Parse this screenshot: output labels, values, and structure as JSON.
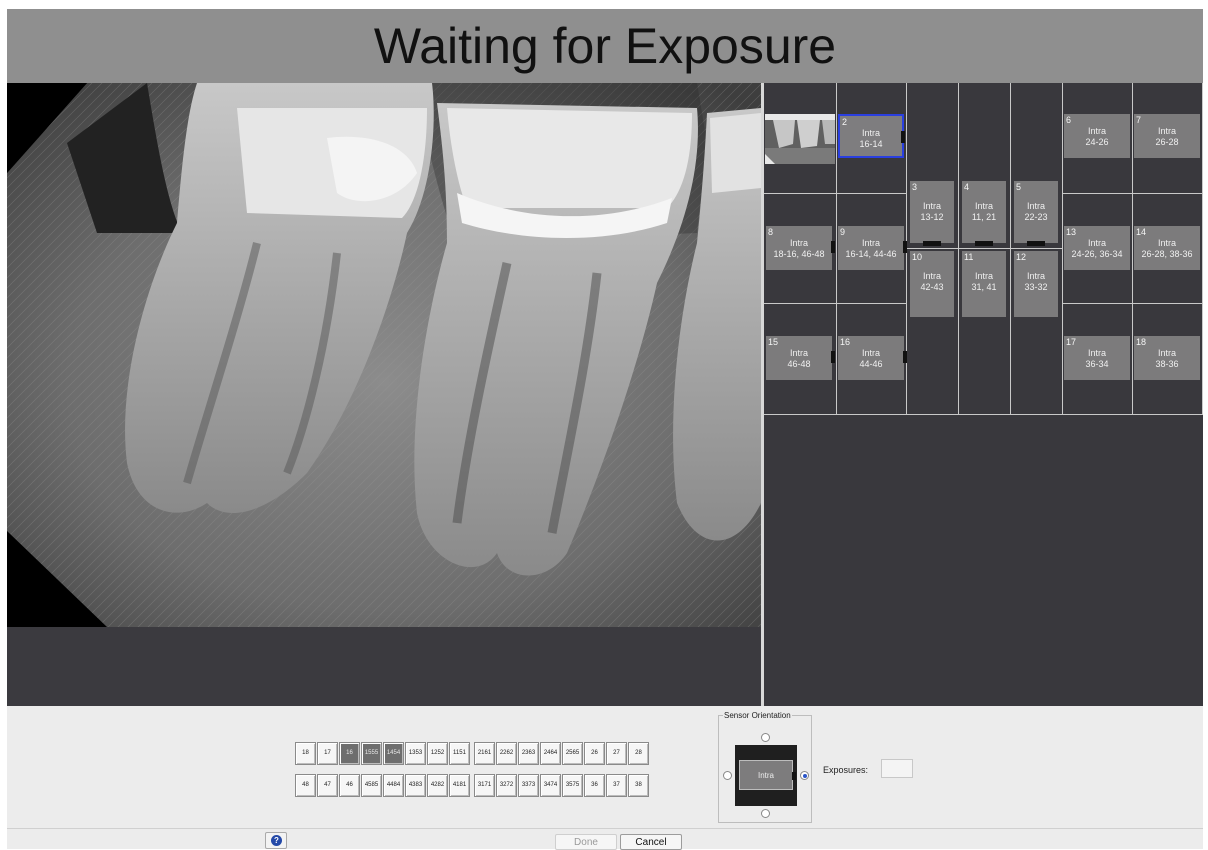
{
  "title": "Waiting for Exposure",
  "accent_selected": "#2a3fe0",
  "mount": {
    "slots": [
      {
        "num": "2",
        "type": "Intra",
        "teeth": "16-14",
        "selected": true
      },
      {
        "num": "3",
        "type": "Intra",
        "teeth": "13-12"
      },
      {
        "num": "4",
        "type": "Intra",
        "teeth": "11, 21"
      },
      {
        "num": "5",
        "type": "Intra",
        "teeth": "22-23"
      },
      {
        "num": "6",
        "type": "Intra",
        "teeth": "24-26"
      },
      {
        "num": "7",
        "type": "Intra",
        "teeth": "26-28"
      },
      {
        "num": "8",
        "type": "Intra",
        "teeth": "18-16, 46-48"
      },
      {
        "num": "9",
        "type": "Intra",
        "teeth": "16-14, 44-46"
      },
      {
        "num": "10",
        "type": "Intra",
        "teeth": "42-43"
      },
      {
        "num": "11",
        "type": "Intra",
        "teeth": "31, 41"
      },
      {
        "num": "12",
        "type": "Intra",
        "teeth": "33-32"
      },
      {
        "num": "13",
        "type": "Intra",
        "teeth": "24-26, 36-34"
      },
      {
        "num": "14",
        "type": "Intra",
        "teeth": "26-28, 38-36"
      },
      {
        "num": "15",
        "type": "Intra",
        "teeth": "46-48"
      },
      {
        "num": "16",
        "type": "Intra",
        "teeth": "44-46"
      },
      {
        "num": "17",
        "type": "Intra",
        "teeth": "36-34"
      },
      {
        "num": "18",
        "type": "Intra",
        "teeth": "38-36"
      }
    ]
  },
  "tooth_selector": {
    "upper": [
      {
        "l1": "18",
        "l2": ""
      },
      {
        "l1": "17",
        "l2": ""
      },
      {
        "l1": "16",
        "l2": "",
        "active": true
      },
      {
        "l1": "15",
        "l2": "55",
        "active": true
      },
      {
        "l1": "14",
        "l2": "54",
        "active": true
      },
      {
        "l1": "13",
        "l2": "53"
      },
      {
        "l1": "12",
        "l2": "52"
      },
      {
        "l1": "11",
        "l2": "51"
      },
      {
        "l1": "21",
        "l2": "61"
      },
      {
        "l1": "22",
        "l2": "62"
      },
      {
        "l1": "23",
        "l2": "63"
      },
      {
        "l1": "24",
        "l2": "64"
      },
      {
        "l1": "25",
        "l2": "65"
      },
      {
        "l1": "26",
        "l2": ""
      },
      {
        "l1": "27",
        "l2": ""
      },
      {
        "l1": "28",
        "l2": ""
      }
    ],
    "lower": [
      {
        "l1": "48",
        "l2": ""
      },
      {
        "l1": "47",
        "l2": ""
      },
      {
        "l1": "46",
        "l2": ""
      },
      {
        "l1": "45",
        "l2": "85"
      },
      {
        "l1": "44",
        "l2": "84"
      },
      {
        "l1": "43",
        "l2": "83"
      },
      {
        "l1": "42",
        "l2": "82"
      },
      {
        "l1": "41",
        "l2": "81"
      },
      {
        "l1": "31",
        "l2": "71"
      },
      {
        "l1": "32",
        "l2": "72"
      },
      {
        "l1": "33",
        "l2": "73"
      },
      {
        "l1": "34",
        "l2": "74"
      },
      {
        "l1": "35",
        "l2": "75"
      },
      {
        "l1": "36",
        "l2": ""
      },
      {
        "l1": "37",
        "l2": ""
      },
      {
        "l1": "38",
        "l2": ""
      }
    ]
  },
  "sensor": {
    "legend": "Sensor Orientation",
    "preview_label": "Intra",
    "selected_orientation": "right"
  },
  "exposures": {
    "label": "Exposures:",
    "value": ""
  },
  "footer": {
    "help_symbol": "?",
    "done_label": "Done",
    "cancel_label": "Cancel"
  }
}
